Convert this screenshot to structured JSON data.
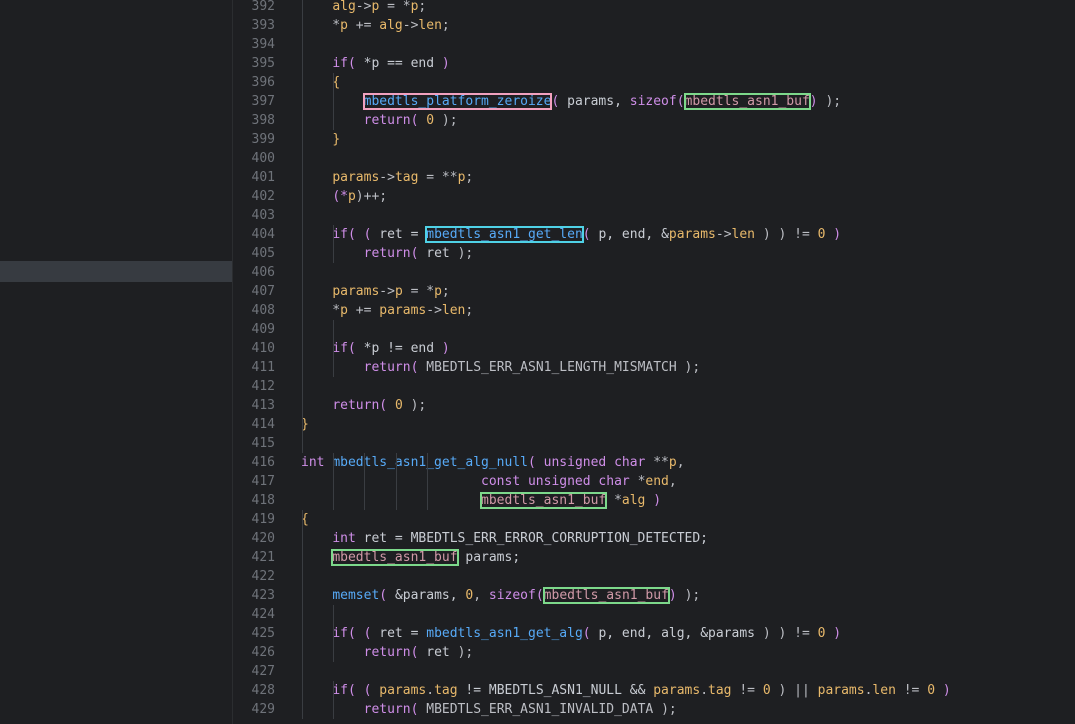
{
  "editor": {
    "colors": {
      "background": "#1e1f22",
      "line_highlight": "#373b41",
      "line_number": "#6f737a",
      "keyword": "#cf8ee8",
      "function": "#57aaf7",
      "field": "#e8b96b",
      "number": "#e8b96b",
      "highlight_pink": "#f2a1bf",
      "highlight_green": "#7dd88b",
      "highlight_cyan": "#4fd1e6"
    },
    "lines": [
      {
        "n": "392",
        "tokens": [
          [
            "    ",
            "t-plain"
          ],
          [
            "alg",
            "t-field"
          ],
          [
            "->",
            "t-op"
          ],
          [
            "p",
            "t-field"
          ],
          [
            " = *",
            "t-op"
          ],
          [
            "p",
            "t-field"
          ],
          [
            ";",
            "t-op"
          ]
        ]
      },
      {
        "n": "393",
        "tokens": [
          [
            "    *",
            "t-op"
          ],
          [
            "p",
            "t-field"
          ],
          [
            " += ",
            "t-op"
          ],
          [
            "alg",
            "t-field"
          ],
          [
            "->",
            "t-op"
          ],
          [
            "len",
            "t-field"
          ],
          [
            ";",
            "t-op"
          ]
        ]
      },
      {
        "n": "394",
        "tokens": []
      },
      {
        "n": "395",
        "tokens": [
          [
            "    ",
            "t-plain"
          ],
          [
            "if",
            "t-kw"
          ],
          [
            "( ",
            "t-paren"
          ],
          [
            "*p == end ",
            "t-var"
          ],
          [
            ")",
            "t-paren"
          ]
        ]
      },
      {
        "n": "396",
        "tokens": [
          [
            "    ",
            "t-plain"
          ],
          [
            "{",
            "t-brace"
          ]
        ]
      },
      {
        "n": "397",
        "tokens": [
          [
            "        ",
            "t-plain"
          ],
          [
            "mbedtls_platform_zeroize",
            "t-fn",
            "box-pink"
          ],
          [
            "( ",
            "t-paren"
          ],
          [
            "params, ",
            "t-var"
          ],
          [
            "sizeof",
            "t-kw"
          ],
          [
            "(",
            "t-paren"
          ],
          [
            "mbedtls_asn1_buf",
            "t-struct",
            "box-green"
          ],
          [
            ") ",
            "t-paren"
          ],
          [
            ");",
            "t-op"
          ]
        ]
      },
      {
        "n": "398",
        "tokens": [
          [
            "        ",
            "t-plain"
          ],
          [
            "return",
            "t-kw"
          ],
          [
            "( ",
            "t-paren"
          ],
          [
            "0",
            "t-num"
          ],
          [
            " );",
            "t-op"
          ]
        ]
      },
      {
        "n": "399",
        "tokens": [
          [
            "    ",
            "t-plain"
          ],
          [
            "}",
            "t-brace"
          ]
        ]
      },
      {
        "n": "400",
        "tokens": []
      },
      {
        "n": "401",
        "tokens": [
          [
            "    ",
            "t-plain"
          ],
          [
            "params",
            "t-field"
          ],
          [
            "->",
            "t-op"
          ],
          [
            "tag",
            "t-field"
          ],
          [
            " = **",
            "t-op"
          ],
          [
            "p",
            "t-field"
          ],
          [
            ";",
            "t-op"
          ]
        ]
      },
      {
        "n": "402",
        "tokens": [
          [
            "    ",
            "t-plain"
          ],
          [
            "(*",
            "t-paren"
          ],
          [
            "p",
            "t-field"
          ],
          [
            ")++;",
            "t-op"
          ]
        ]
      },
      {
        "n": "403",
        "tokens": []
      },
      {
        "n": "404",
        "tokens": [
          [
            "    ",
            "t-plain"
          ],
          [
            "if",
            "t-kw"
          ],
          [
            "( ( ",
            "t-paren"
          ],
          [
            "ret = ",
            "t-var"
          ],
          [
            "mbedtls_asn1_get_len",
            "t-fn",
            "box-cyan"
          ],
          [
            "( ",
            "t-paren"
          ],
          [
            "p, end, &",
            "t-var"
          ],
          [
            "params",
            "t-field"
          ],
          [
            "->",
            "t-op"
          ],
          [
            "len",
            "t-field"
          ],
          [
            " ) ) != ",
            "t-op"
          ],
          [
            "0",
            "t-num"
          ],
          [
            " )",
            "t-paren"
          ]
        ]
      },
      {
        "n": "405",
        "tokens": [
          [
            "        ",
            "t-plain"
          ],
          [
            "return",
            "t-kw"
          ],
          [
            "( ",
            "t-paren"
          ],
          [
            "ret ",
            "t-var"
          ],
          [
            ");",
            "t-op"
          ]
        ]
      },
      {
        "n": "406",
        "tokens": []
      },
      {
        "n": "407",
        "tokens": [
          [
            "    ",
            "t-plain"
          ],
          [
            "params",
            "t-field"
          ],
          [
            "->",
            "t-op"
          ],
          [
            "p",
            "t-field"
          ],
          [
            " = *",
            "t-op"
          ],
          [
            "p",
            "t-field"
          ],
          [
            ";",
            "t-op"
          ]
        ]
      },
      {
        "n": "408",
        "tokens": [
          [
            "    *",
            "t-op"
          ],
          [
            "p",
            "t-field"
          ],
          [
            " += ",
            "t-op"
          ],
          [
            "params",
            "t-field"
          ],
          [
            "->",
            "t-op"
          ],
          [
            "len",
            "t-field"
          ],
          [
            ";",
            "t-op"
          ]
        ]
      },
      {
        "n": "409",
        "tokens": []
      },
      {
        "n": "410",
        "tokens": [
          [
            "    ",
            "t-plain"
          ],
          [
            "if",
            "t-kw"
          ],
          [
            "( ",
            "t-paren"
          ],
          [
            "*p != end ",
            "t-var"
          ],
          [
            ")",
            "t-paren"
          ]
        ]
      },
      {
        "n": "411",
        "tokens": [
          [
            "        ",
            "t-plain"
          ],
          [
            "return",
            "t-kw"
          ],
          [
            "( ",
            "t-paren"
          ],
          [
            "MBEDTLS_ERR_ASN1_LENGTH_MISMATCH ",
            "t-macro"
          ],
          [
            ");",
            "t-op"
          ]
        ]
      },
      {
        "n": "412",
        "tokens": []
      },
      {
        "n": "413",
        "tokens": [
          [
            "    ",
            "t-plain"
          ],
          [
            "return",
            "t-kw"
          ],
          [
            "( ",
            "t-paren"
          ],
          [
            "0",
            "t-num"
          ],
          [
            " );",
            "t-op"
          ]
        ]
      },
      {
        "n": "414",
        "tokens": [
          [
            "}",
            "t-brace"
          ]
        ]
      },
      {
        "n": "415",
        "tokens": []
      },
      {
        "n": "416",
        "tokens": [
          [
            "int ",
            "t-kw"
          ],
          [
            "mbedtls_asn1_get_alg_null",
            "t-fn"
          ],
          [
            "( ",
            "t-paren"
          ],
          [
            "unsigned char ",
            "t-kw"
          ],
          [
            "**",
            "t-op"
          ],
          [
            "p",
            "t-field"
          ],
          [
            ",",
            "t-op"
          ]
        ]
      },
      {
        "n": "417",
        "tokens": [
          [
            "                       ",
            "t-plain"
          ],
          [
            "const unsigned char ",
            "t-kw"
          ],
          [
            "*",
            "t-op"
          ],
          [
            "end",
            "t-field"
          ],
          [
            ",",
            "t-op"
          ]
        ]
      },
      {
        "n": "418",
        "tokens": [
          [
            "                       ",
            "t-plain"
          ],
          [
            "mbedtls_asn1_buf",
            "t-struct",
            "box-green"
          ],
          [
            " *",
            "t-op"
          ],
          [
            "alg",
            "t-field"
          ],
          [
            " )",
            "t-paren"
          ]
        ]
      },
      {
        "n": "419",
        "tokens": [
          [
            "{",
            "t-brace"
          ]
        ]
      },
      {
        "n": "420",
        "tokens": [
          [
            "    ",
            "t-plain"
          ],
          [
            "int ",
            "t-kw"
          ],
          [
            "ret = MBEDTLS_ERR_ERROR_CORRUPTION_DETECTED;",
            "t-var"
          ]
        ]
      },
      {
        "n": "421",
        "tokens": [
          [
            "    ",
            "t-plain"
          ],
          [
            "mbedtls_asn1_buf",
            "t-struct",
            "box-green"
          ],
          [
            " params;",
            "t-var"
          ]
        ]
      },
      {
        "n": "422",
        "tokens": []
      },
      {
        "n": "423",
        "tokens": [
          [
            "    ",
            "t-plain"
          ],
          [
            "memset",
            "t-fn"
          ],
          [
            "( ",
            "t-paren"
          ],
          [
            "&params, ",
            "t-var"
          ],
          [
            "0",
            "t-num"
          ],
          [
            ", ",
            "t-op"
          ],
          [
            "sizeof",
            "t-kw"
          ],
          [
            "(",
            "t-paren"
          ],
          [
            "mbedtls_asn1_buf",
            "t-struct",
            "box-green"
          ],
          [
            ") ",
            "t-paren"
          ],
          [
            ");",
            "t-op"
          ]
        ]
      },
      {
        "n": "424",
        "tokens": []
      },
      {
        "n": "425",
        "tokens": [
          [
            "    ",
            "t-plain"
          ],
          [
            "if",
            "t-kw"
          ],
          [
            "( ( ",
            "t-paren"
          ],
          [
            "ret = ",
            "t-var"
          ],
          [
            "mbedtls_asn1_get_alg",
            "t-fn"
          ],
          [
            "( ",
            "t-paren"
          ],
          [
            "p, end, alg, &params ",
            "t-var"
          ],
          [
            ") ) != ",
            "t-op"
          ],
          [
            "0",
            "t-num"
          ],
          [
            " )",
            "t-paren"
          ]
        ]
      },
      {
        "n": "426",
        "tokens": [
          [
            "        ",
            "t-plain"
          ],
          [
            "return",
            "t-kw"
          ],
          [
            "( ",
            "t-paren"
          ],
          [
            "ret ",
            "t-var"
          ],
          [
            ");",
            "t-op"
          ]
        ]
      },
      {
        "n": "427",
        "tokens": []
      },
      {
        "n": "428",
        "tokens": [
          [
            "    ",
            "t-plain"
          ],
          [
            "if",
            "t-kw"
          ],
          [
            "( ( ",
            "t-paren"
          ],
          [
            "params",
            "t-field"
          ],
          [
            ".",
            "t-op"
          ],
          [
            "tag",
            "t-field"
          ],
          [
            " != MBEDTLS_ASN1_NULL && ",
            "t-var"
          ],
          [
            "params",
            "t-field"
          ],
          [
            ".",
            "t-op"
          ],
          [
            "tag",
            "t-field"
          ],
          [
            " != ",
            "t-op"
          ],
          [
            "0",
            "t-num"
          ],
          [
            " ) || ",
            "t-op"
          ],
          [
            "params",
            "t-field"
          ],
          [
            ".",
            "t-op"
          ],
          [
            "len",
            "t-field"
          ],
          [
            " != ",
            "t-op"
          ],
          [
            "0",
            "t-num"
          ],
          [
            " )",
            "t-paren"
          ]
        ]
      },
      {
        "n": "429",
        "tokens": [
          [
            "        ",
            "t-plain"
          ],
          [
            "return",
            "t-kw"
          ],
          [
            "( ",
            "t-paren"
          ],
          [
            "MBEDTLS_ERR_ASN1_INVALID_DATA ",
            "t-macro"
          ],
          [
            ");",
            "t-op"
          ]
        ]
      }
    ]
  }
}
